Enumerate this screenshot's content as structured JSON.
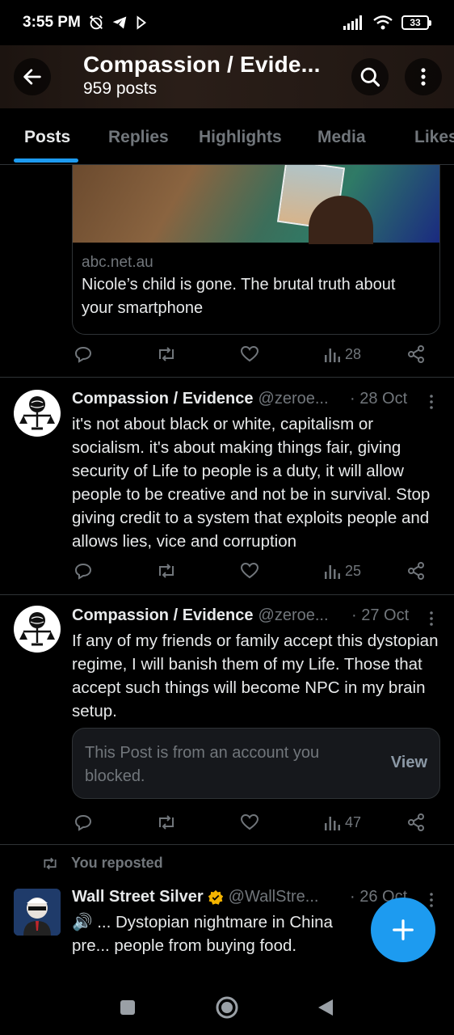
{
  "status_bar": {
    "time": "3:55 PM",
    "battery": "33"
  },
  "header": {
    "title": "Compassion / Evide...",
    "subtitle": "959 posts"
  },
  "tabs": [
    {
      "label": "Posts",
      "active": true
    },
    {
      "label": "Replies",
      "active": false
    },
    {
      "label": "Highlights",
      "active": false
    },
    {
      "label": "Media",
      "active": false
    },
    {
      "label": "Likes",
      "active": false
    }
  ],
  "link_card": {
    "domain": "abc.net.au",
    "text": "Nicole’s child is gone. The brutal truth about your smartphone",
    "views": "28"
  },
  "posts": [
    {
      "name": "Compassion / Evidence",
      "handle": "@zeroe...",
      "date": "· 28 Oct",
      "text": "it's not about black or white, capitalism or socialism. it's about making things fair, giving security of Life to people is a duty, it will allow people to be creative and not be in survival. Stop giving credit to a system that exploits people and allows lies, vice and corruption",
      "views": "25"
    },
    {
      "name": "Compassion / Evidence",
      "handle": "@zeroe...",
      "date": "· 27 Oct",
      "text": "If any of my friends or family accept this dystopian regime, I will banish them of my Life. Those that accept such things will become NPC in my brain setup.",
      "blocked_text": "This Post is from an account you blocked.",
      "blocked_action": "View",
      "views": "47"
    },
    {
      "repost_label": "You reposted",
      "name": "Wall Street Silver",
      "handle": "@WallStre...",
      "date": "· 26 Oct",
      "text": "🔊 ... Dystopian nightmare in China pre... people from buying food."
    }
  ],
  "colors": {
    "accent": "#1d9bf0",
    "background": "#000000",
    "muted": "#71767b",
    "verified": "#f4b400"
  }
}
